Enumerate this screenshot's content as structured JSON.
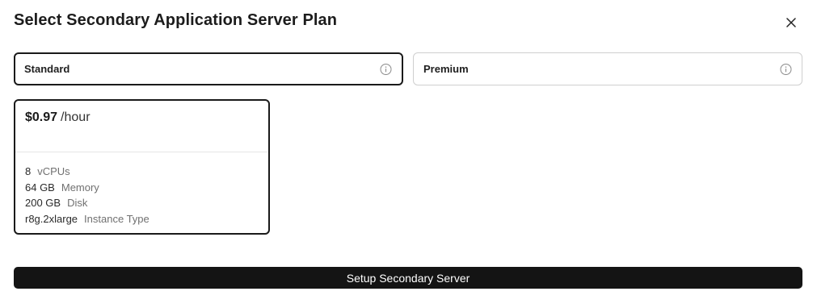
{
  "dialog": {
    "title": "Select Secondary Application Server Plan"
  },
  "tabs": [
    {
      "label": "Standard",
      "selected": true,
      "icon": "info-icon"
    },
    {
      "label": "Premium",
      "selected": false,
      "icon": "info-icon"
    }
  ],
  "plan": {
    "price": "$0.97",
    "unit": "/hour",
    "specs": [
      {
        "value": "8",
        "label": "vCPUs"
      },
      {
        "value": "64 GB",
        "label": "Memory"
      },
      {
        "value": "200 GB",
        "label": "Disk"
      },
      {
        "value": "r8g.2xlarge",
        "label": "Instance Type"
      }
    ]
  },
  "actions": {
    "setup_label": "Setup Secondary Server"
  },
  "colors": {
    "button_bg": "#141414",
    "selected_border": "#1a1a1a",
    "muted_text": "#707070"
  }
}
